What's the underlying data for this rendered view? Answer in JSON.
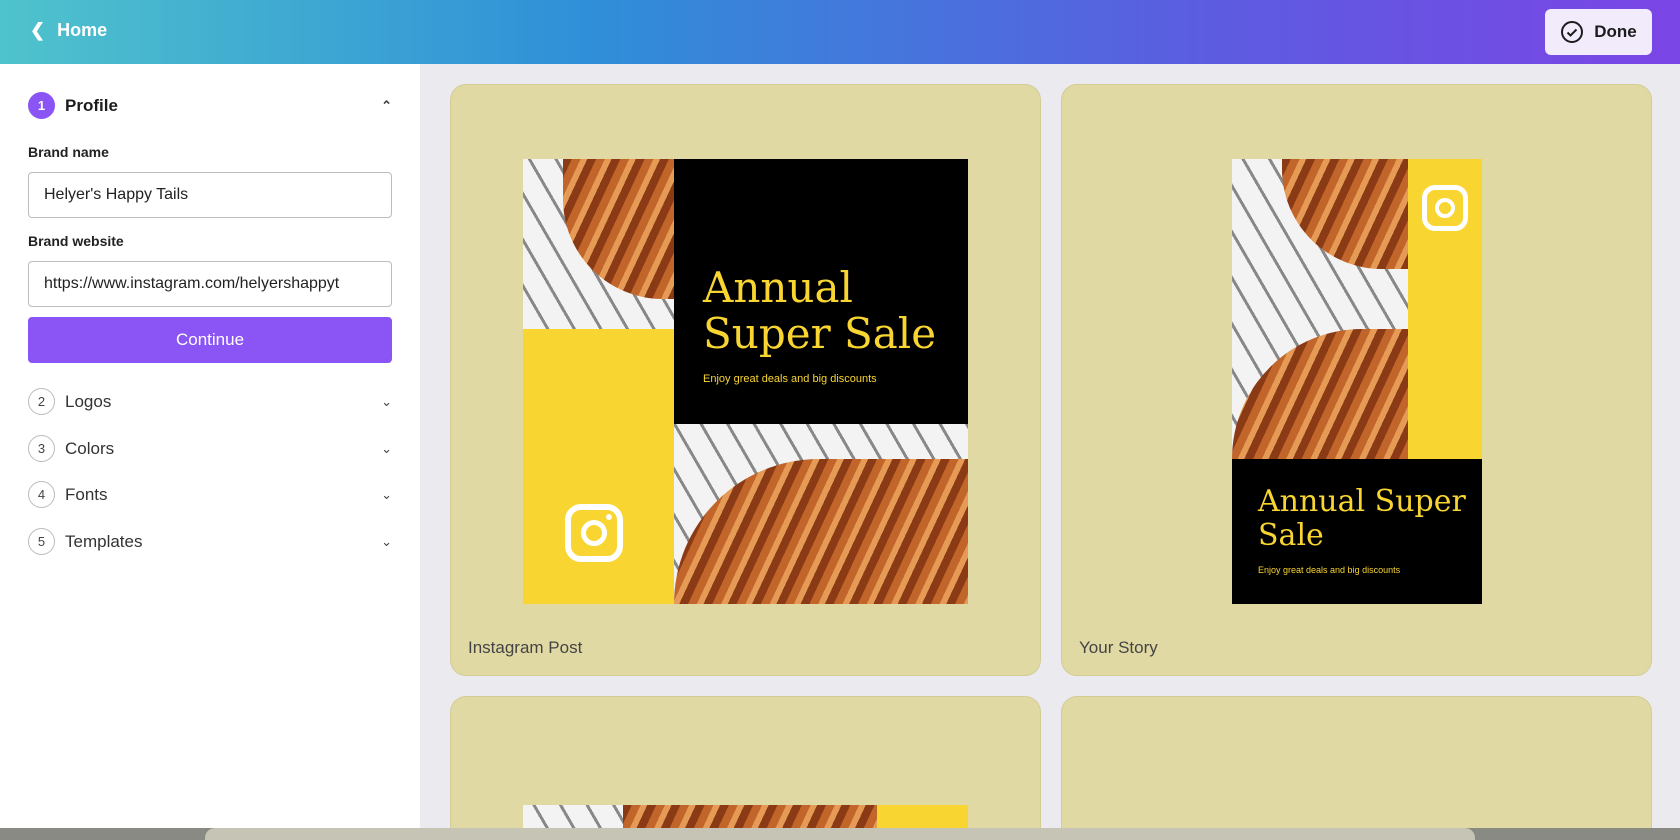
{
  "header": {
    "home_label": "Home",
    "done_label": "Done"
  },
  "sidebar": {
    "steps": [
      {
        "num": "1",
        "label": "Profile"
      },
      {
        "num": "2",
        "label": "Logos"
      },
      {
        "num": "3",
        "label": "Colors"
      },
      {
        "num": "4",
        "label": "Fonts"
      },
      {
        "num": "5",
        "label": "Templates"
      }
    ],
    "brand_name_label": "Brand name",
    "brand_name_value": "Helyer's Happy Tails",
    "brand_website_label": "Brand website",
    "brand_website_value": "https://www.instagram.com/helyershappyt",
    "continue_label": "Continue"
  },
  "templates": [
    {
      "label": "Instagram Post",
      "title_line1": "Annual",
      "title_line2": "Super Sale",
      "subtitle": "Enjoy great deals and big discounts"
    },
    {
      "label": "Your Story",
      "title_line1": "Annual Super",
      "title_line2": "Sale",
      "subtitle": "Enjoy great deals and big discounts"
    }
  ],
  "colors": {
    "accent": "#8b55f5",
    "card": "#e1d9a4",
    "poster_yellow": "#f9d532"
  }
}
